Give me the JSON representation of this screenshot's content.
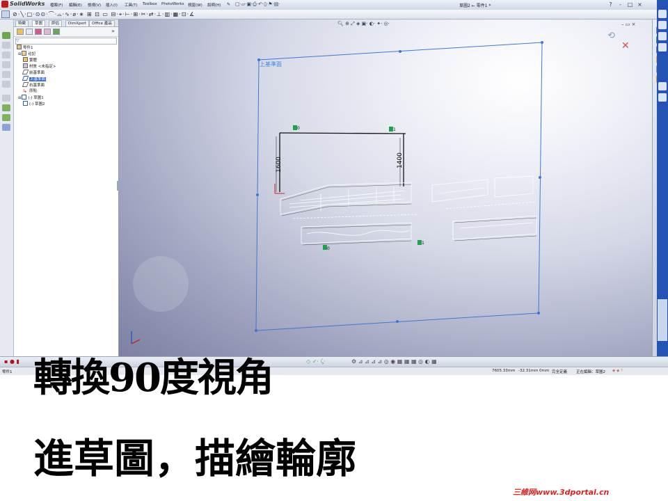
{
  "app": {
    "name": "SolidWorks",
    "document_title": "草圖2 ← 零件1 *",
    "menu": [
      "檔案(F)",
      "編輯(E)",
      "檢視(V)",
      "插入(I)",
      "工具(T)",
      "Toolbox",
      "PhotoWorks",
      "視窗(W)",
      "說明(H)"
    ],
    "window_controls": [
      "?",
      "-",
      "□",
      "×"
    ]
  },
  "left_panel": {
    "tabs": [
      "特徵",
      "草圖",
      "評估",
      "DimXpert",
      "Office 產品"
    ],
    "active_tab": "草圖",
    "tree": [
      {
        "label": "零件1",
        "level": 0,
        "icon": "part-icon"
      },
      {
        "label": "註記",
        "level": 1,
        "icon": "annotations-icon"
      },
      {
        "label": "實體",
        "level": 1,
        "icon": "solid-bodies-icon"
      },
      {
        "label": "材質 <未指定>",
        "level": 1,
        "icon": "material-icon"
      },
      {
        "label": "前基準面",
        "level": 1,
        "icon": "plane-icon"
      },
      {
        "label": "上基準面",
        "level": 1,
        "icon": "plane-icon",
        "selected": true
      },
      {
        "label": "右基準面",
        "level": 1,
        "icon": "plane-icon"
      },
      {
        "label": "原點",
        "level": 1,
        "icon": "origin-icon"
      },
      {
        "label": "(-) 草圖1",
        "level": 1,
        "icon": "sketch-icon"
      },
      {
        "label": "(-) 草圖2",
        "level": 1,
        "icon": "sketch-icon"
      }
    ]
  },
  "viewport": {
    "plane_label": "上基準面",
    "dimensions": [
      "1600",
      "1400"
    ],
    "relation_tags": [
      "0",
      "1",
      "0",
      "1"
    ]
  },
  "status_bar": {
    "left": "零件1",
    "x_coord": "7605.33mm",
    "y_coord": "-32.31mm",
    "z_coord": "0mm",
    "state": "完全定義",
    "editing": "正在編輯：草圖2"
  },
  "captions": {
    "line1": "轉換90度視角",
    "line2": "進草圖，描繪輪廓"
  },
  "watermark": "三維网www.3dportal.cn",
  "colors": {
    "sketch_line": "#111111",
    "plane_outline": "#3b78d6",
    "relation_tag": "#1ba34a",
    "watermark": "#e0201e",
    "title_bar": "#dde4ee"
  }
}
